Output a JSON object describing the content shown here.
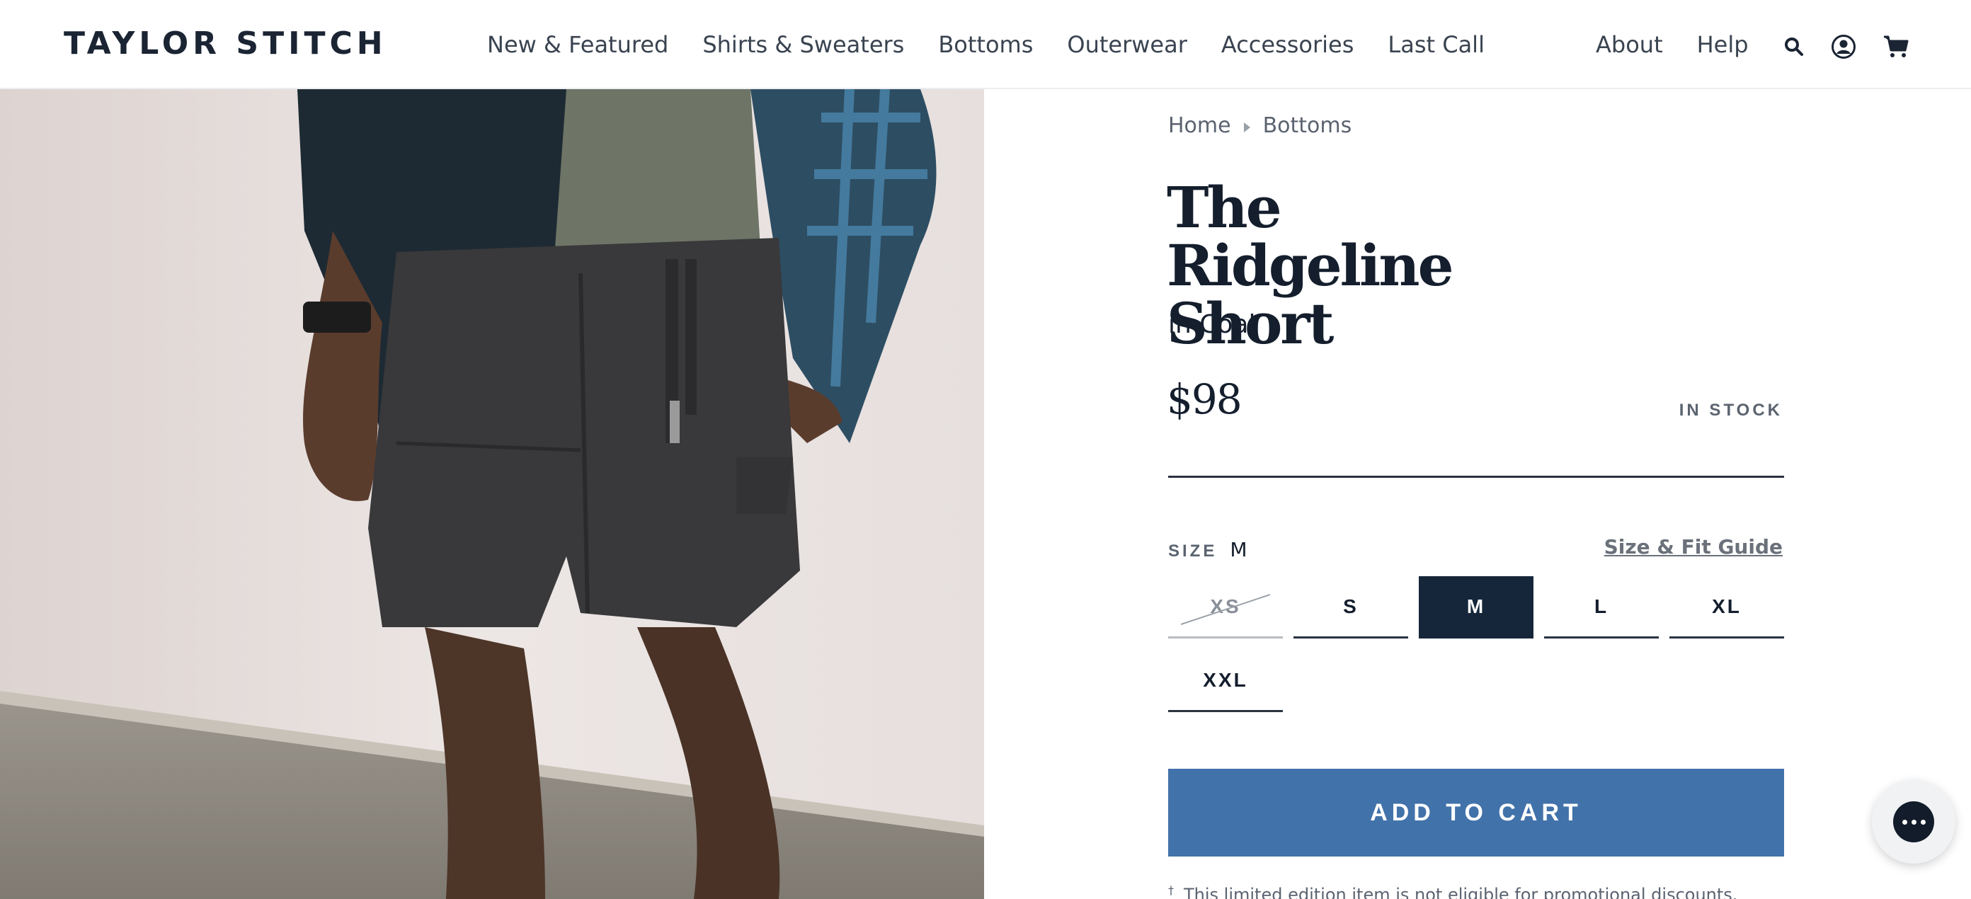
{
  "brand": {
    "logo_text": "TAYLOR STITCH"
  },
  "nav": {
    "items": [
      "New & Featured",
      "Shirts & Sweaters",
      "Bottoms",
      "Outerwear",
      "Accessories",
      "Last Call"
    ],
    "right_links": [
      "About",
      "Help"
    ],
    "icons": [
      "search-icon",
      "account-icon",
      "cart-icon"
    ]
  },
  "breadcrumb": {
    "home": "Home",
    "current": "Bottoms"
  },
  "product": {
    "title": "The Ridgeline Short",
    "color_line": "in Coal",
    "price": "$98",
    "stock_status": "IN STOCK"
  },
  "size": {
    "label": "SIZE",
    "selected": "M",
    "fit_guide_link": "Size & Fit Guide",
    "options": [
      {
        "label": "XS",
        "state": "unavailable"
      },
      {
        "label": "S",
        "state": "available"
      },
      {
        "label": "M",
        "state": "selected"
      },
      {
        "label": "L",
        "state": "available"
      },
      {
        "label": "XL",
        "state": "available"
      },
      {
        "label": "XXL",
        "state": "available"
      }
    ]
  },
  "cart": {
    "add_label": "ADD TO CART"
  },
  "promo_note": {
    "marker": "†",
    "text": "This limited edition item is not eligible for promotional discounts."
  },
  "chat": {
    "icon": "chat-icon"
  },
  "colors": {
    "accent": "#4272aa",
    "navy": "#16263a",
    "text": "#141e2d",
    "muted": "#5b6370"
  }
}
